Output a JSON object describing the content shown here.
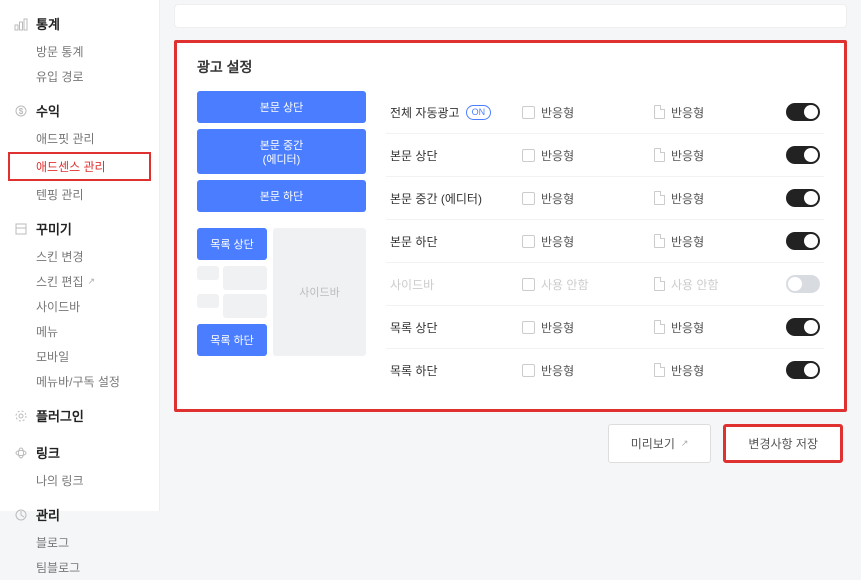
{
  "sidebar": {
    "sections": [
      {
        "title": "통계",
        "items": [
          "방문 통계",
          "유입 경로"
        ]
      },
      {
        "title": "수익",
        "items": [
          "애드핏 관리",
          "애드센스 관리",
          "텐핑 관리"
        ],
        "highlightIndex": 1
      },
      {
        "title": "꾸미기",
        "items": [
          "스킨 변경",
          "스킨 편집",
          "사이드바",
          "메뉴",
          "모바일",
          "메뉴바/구독 설정"
        ],
        "extIndex": 1
      },
      {
        "title": "플러그인",
        "items": []
      },
      {
        "title": "링크",
        "items": [
          "나의 링크"
        ]
      },
      {
        "title": "관리",
        "items": [
          "블로그",
          "팀블로그"
        ]
      }
    ]
  },
  "panel": {
    "title": "광고 설정",
    "preview": {
      "slots": {
        "top": "본문 상단",
        "mid1": "본문 중간",
        "mid2": "(에디터)",
        "bottom": "본문 하단",
        "listTop": "목록 상단",
        "listBottom": "목록 하단",
        "sidebar": "사이드바"
      }
    },
    "rows": [
      {
        "label": "전체 자동광고",
        "badge": "ON",
        "c1": "반응형",
        "c2": "반응형",
        "on": true
      },
      {
        "label": "본문 상단",
        "c1": "반응형",
        "c2": "반응형",
        "on": true
      },
      {
        "label": "본문 중간 (에디터)",
        "c1": "반응형",
        "c2": "반응형",
        "on": true
      },
      {
        "label": "본문 하단",
        "c1": "반응형",
        "c2": "반응형",
        "on": true
      },
      {
        "label": "사이드바",
        "c1": "사용 안함",
        "c2": "사용 안함",
        "on": false,
        "disabled": true
      },
      {
        "label": "목록 상단",
        "c1": "반응형",
        "c2": "반응형",
        "on": true
      },
      {
        "label": "목록 하단",
        "c1": "반응형",
        "c2": "반응형",
        "on": true
      }
    ],
    "buttons": {
      "preview": "미리보기",
      "save": "변경사항 저장"
    }
  }
}
